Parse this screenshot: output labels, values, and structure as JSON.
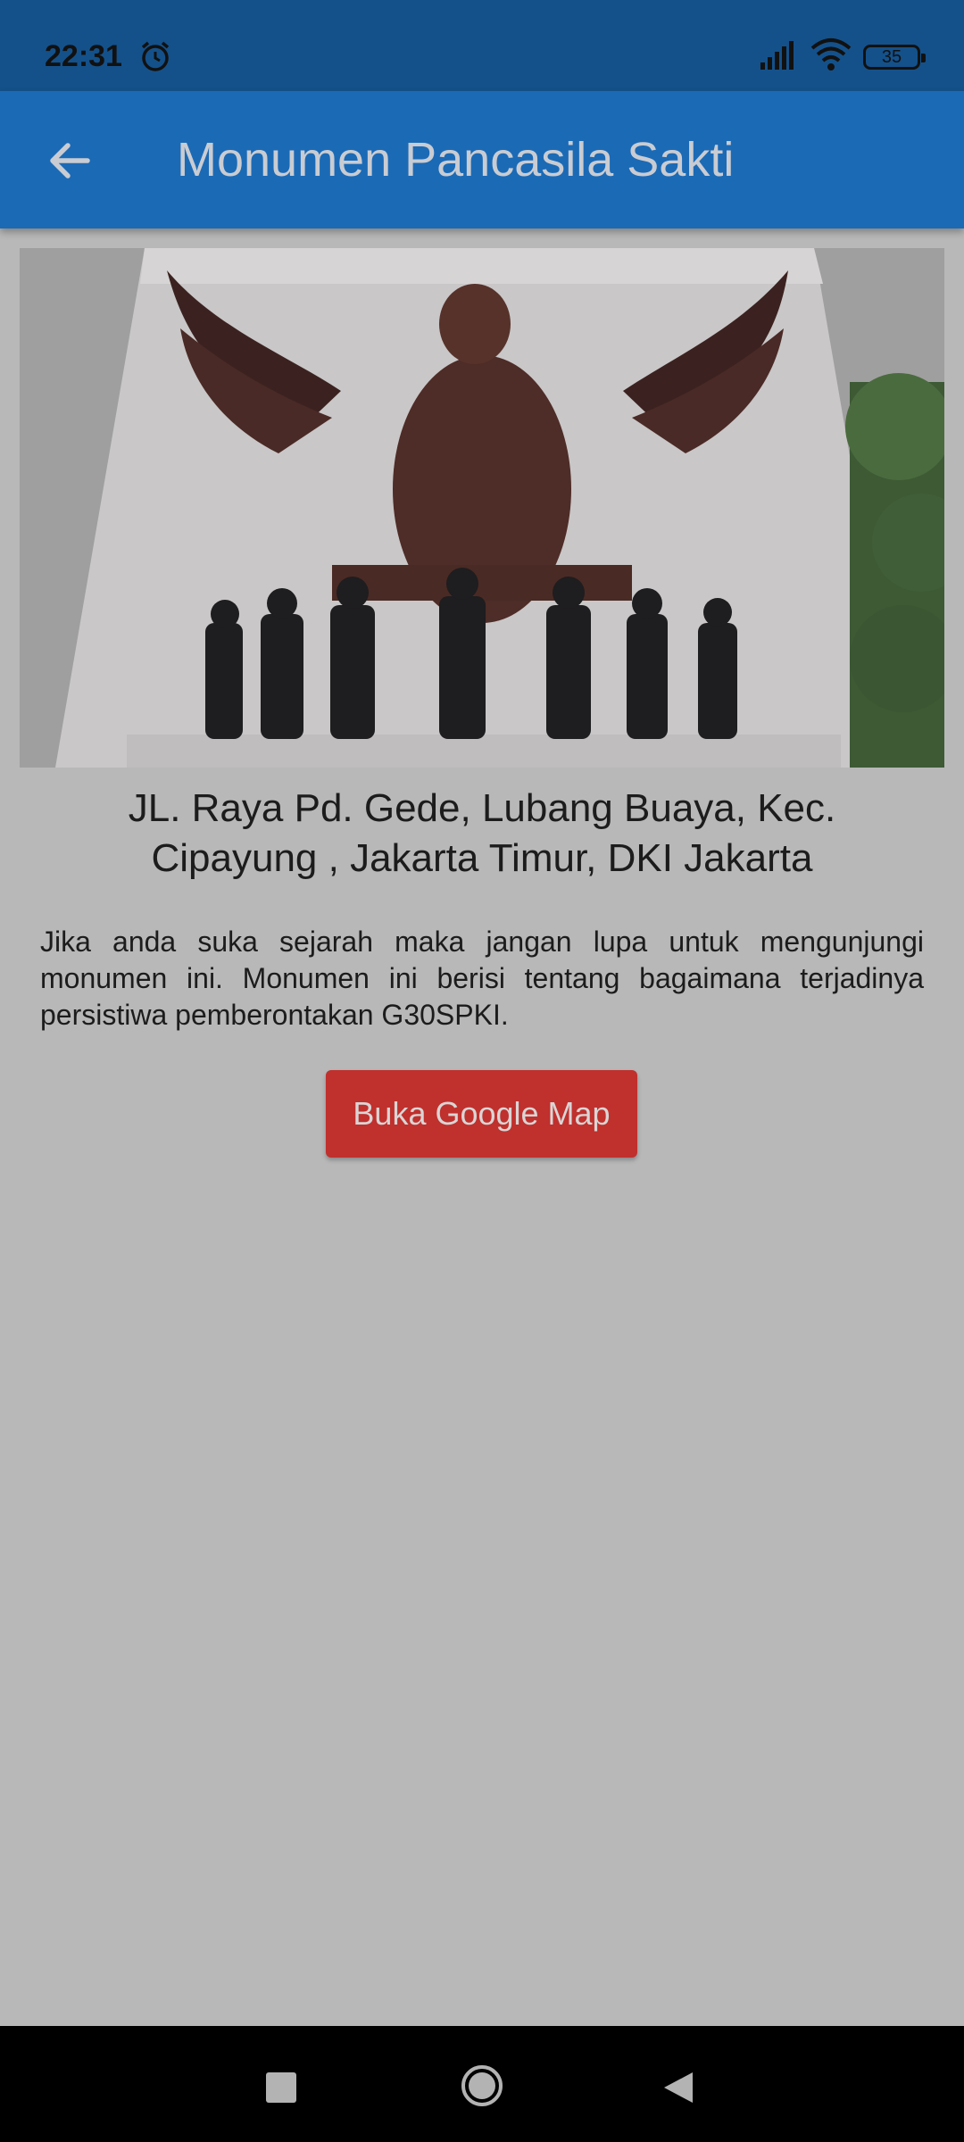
{
  "status_bar": {
    "time": "22:31",
    "battery": "35"
  },
  "app_bar": {
    "title": "Monumen Pancasila Sakti"
  },
  "detail": {
    "address": "JL. Raya Pd. Gede, Lubang Buaya, Kec. Cipayung , Jakarta Timur, DKI Jakarta",
    "description": "Jika anda suka sejarah maka jangan lupa untuk mengunjungi monumen ini. Monumen ini berisi tentang bagaimana terjadinya persistiwa pemberontakan G30SPKI.",
    "button_label": "Buka Google Map"
  },
  "colors": {
    "status_bar": "#14518a",
    "app_bar": "#1b6ab6",
    "background": "#b8b8b8",
    "button": "#c0302d"
  },
  "icons": [
    "alarm-icon",
    "signal-icon",
    "wifi-icon",
    "battery-icon",
    "back-arrow-icon",
    "recents-icon",
    "home-icon",
    "nav-back-icon"
  ]
}
